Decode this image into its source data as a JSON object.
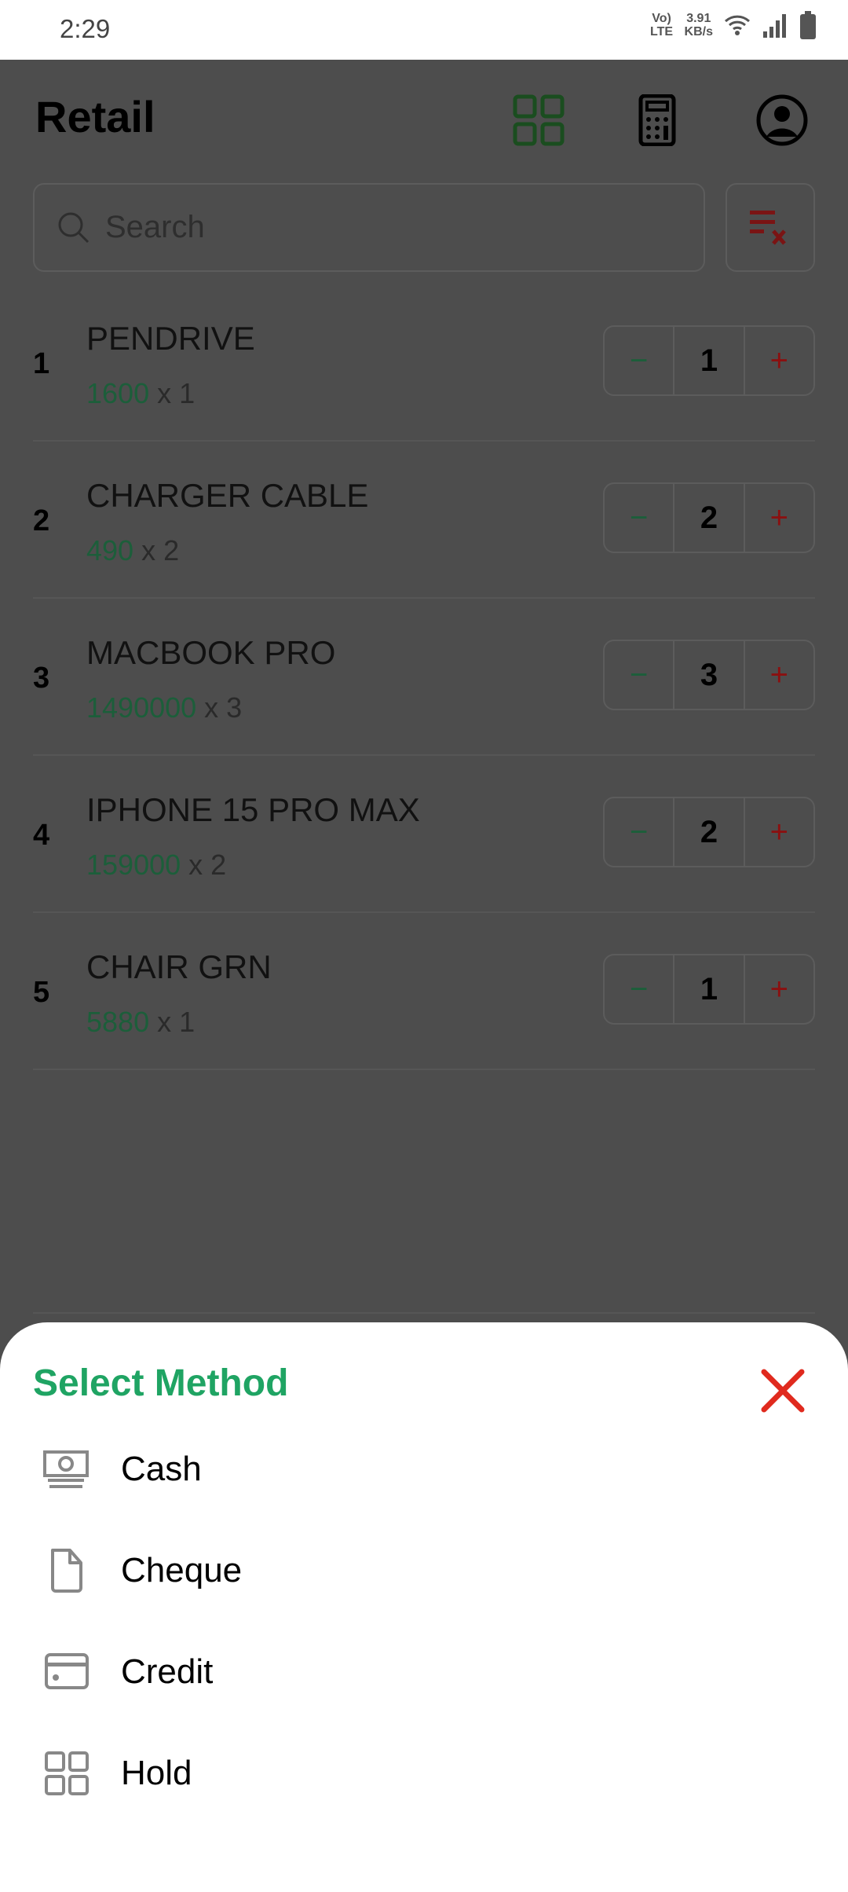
{
  "status_bar": {
    "time": "2:29",
    "network": "Vo) LTE",
    "speed_value": "3.91",
    "speed_unit": "KB/s"
  },
  "header": {
    "title": "Retail",
    "icons": [
      "grid-icon",
      "calculator-icon",
      "profile-icon"
    ]
  },
  "search": {
    "placeholder": "Search",
    "value": ""
  },
  "items": [
    {
      "index": "1",
      "name": "PENDRIVE",
      "price": "1600",
      "qty_text": "x 1",
      "qty": "1"
    },
    {
      "index": "2",
      "name": "CHARGER CABLE",
      "price": "490",
      "qty_text": "x 2",
      "qty": "2"
    },
    {
      "index": "3",
      "name": "MACBOOK PRO",
      "price": "1490000",
      "qty_text": "x 3",
      "qty": "3"
    },
    {
      "index": "4",
      "name": "IPHONE 15 PRO MAX",
      "price": "159000",
      "qty_text": "x 2",
      "qty": "2"
    },
    {
      "index": "5",
      "name": "CHAIR GRN",
      "price": "5880",
      "qty_text": "x 1",
      "qty": "1"
    }
  ],
  "stepper": {
    "minus": "−",
    "plus": "+"
  },
  "sheet": {
    "title": "Select Method",
    "options": [
      {
        "label": "Cash",
        "icon": "cash-icon"
      },
      {
        "label": "Cheque",
        "icon": "document-icon"
      },
      {
        "label": "Credit",
        "icon": "credit-card-icon"
      },
      {
        "label": "Hold",
        "icon": "grid-icon"
      }
    ]
  },
  "colors": {
    "accent": "#1fa463",
    "danger": "#e02a1e"
  }
}
